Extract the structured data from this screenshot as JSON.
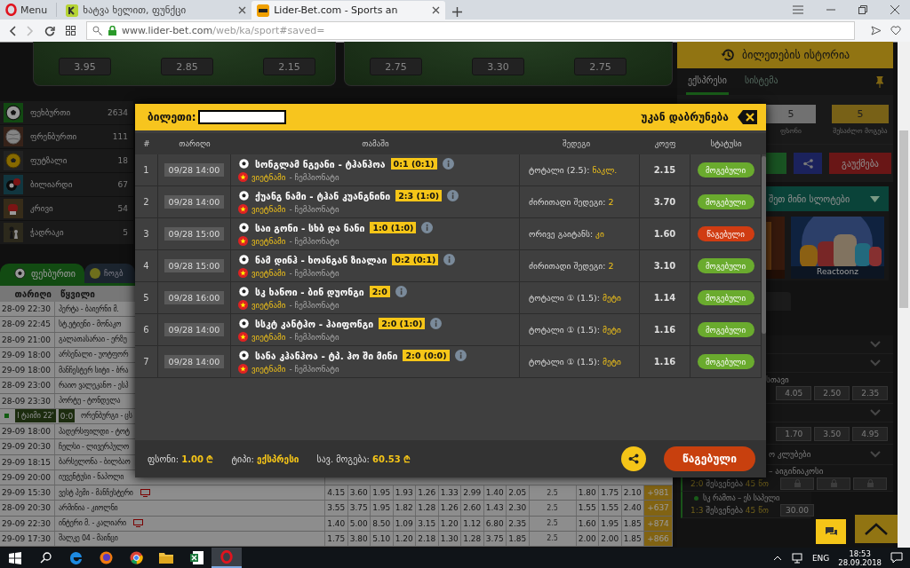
{
  "browser": {
    "menu_label": "Menu",
    "tabs": [
      {
        "label": "ხატვა ხელით, ფუნქცი",
        "selected": false,
        "kind": "quiz"
      },
      {
        "label": "Lider-Bet.com - Sports an",
        "selected": true,
        "kind": "site"
      }
    ],
    "url_host": "www.lider-bet.com",
    "url_path": "/web/ka/sport#saved="
  },
  "featured_cards": [
    {
      "odds": [
        "3.95",
        "2.85",
        "2.15"
      ]
    },
    {
      "odds": [
        "2.75",
        "3.30",
        "2.75"
      ]
    }
  ],
  "sports": [
    {
      "name": "ფეხბურთი",
      "count": "2634",
      "kind": "football"
    },
    {
      "name": "ფრენბურთი",
      "count": "111",
      "kind": "volleyball"
    },
    {
      "name": "ფუტზალი",
      "count": "18",
      "kind": "futsal"
    },
    {
      "name": "ბილიარდი",
      "count": "67",
      "kind": "billiards"
    },
    {
      "name": "კრივი",
      "count": "54",
      "kind": "boxing"
    },
    {
      "name": "ჭადრაკი",
      "count": "5",
      "kind": "chess"
    }
  ],
  "sport_tabs": [
    {
      "label": "ფეხბურთი",
      "selected": true,
      "kind": "football"
    },
    {
      "label": "ჩოგბ",
      "selected": false,
      "kind": "tennis"
    }
  ],
  "matches": {
    "columns": [
      "თარიღი",
      "წყვილი"
    ],
    "rows": [
      {
        "date": "28-09 22:30",
        "teams": "ჰერტა - ბაიერნი მ."
      },
      {
        "date": "28-09 22:45",
        "teams": "სტ.ეტიენი - მონაკო"
      },
      {
        "date": "28-09 21:00",
        "teams": "გალათასარაი - ერზუ"
      },
      {
        "date": "29-09 18:00",
        "teams": "არსენალი - უოტფორ"
      },
      {
        "date": "29-09 18:00",
        "teams": "მანჩესტერ სიტი - ბრა"
      },
      {
        "date": "28-09 23:00",
        "teams": "რაიო ვალეკანო - ესპ"
      },
      {
        "date": "28-09 23:30",
        "teams": "პორტუ - ტონდელა"
      },
      {
        "live": true,
        "period": "I ტაიმი 22'",
        "score": "0:0",
        "teams": "ორენბურგი - ცს"
      },
      {
        "date": "29-09 18:00",
        "teams": "ჰადერსფილდი - ტოტ"
      },
      {
        "date": "29-09 20:30",
        "teams": "ჩელსი - ლივერპულო"
      },
      {
        "date": "29-09 18:15",
        "teams": "ბარსელონა - ბილბაო"
      },
      {
        "date": "29-09 20:00",
        "teams": "იუვენტუსი - ნაპოლი"
      },
      {
        "date": "29-09 15:30",
        "teams": "ვესტ ჰემი - მანჩესტერი",
        "tv": true,
        "odds": [
          "4.15",
          "3.60",
          "1.95",
          "1.93",
          "1.26",
          "1.33",
          "2.99",
          "1.40",
          "2.05"
        ],
        "total": "2.5",
        "total_odds": [
          "1.80",
          "1.75",
          "2.10"
        ],
        "more": "+981"
      },
      {
        "date": "28-09 20:30",
        "teams": "არმინია - კიოლნი",
        "tv": false,
        "odds": [
          "3.55",
          "3.75",
          "1.95",
          "1.82",
          "1.28",
          "1.26",
          "2.60",
          "1.43",
          "2.30"
        ],
        "total": "2.5",
        "total_odds": [
          "1.55",
          "1.55",
          "2.40"
        ],
        "more": "+637"
      },
      {
        "date": "29-09 22:30",
        "teams": "ინტერი მ. - კალიარი",
        "tv": true,
        "odds": [
          "1.40",
          "5.00",
          "8.50",
          "1.09",
          "3.15",
          "1.20",
          "1.12",
          "6.80",
          "2.35"
        ],
        "total": "2.5",
        "total_odds": [
          "1.60",
          "1.95",
          "1.85"
        ],
        "more": "+874"
      },
      {
        "date": "29-09 17:30",
        "teams": "შალკე 04 - მაინცი",
        "tv": false,
        "odds": [
          "1.75",
          "3.80",
          "5.10",
          "1.20",
          "2.18",
          "1.30",
          "1.28",
          "3.75",
          "1.85"
        ],
        "total": "2.5",
        "total_odds": [
          "2.00",
          "2.00",
          "1.85"
        ],
        "more": "+866"
      }
    ]
  },
  "bet_slip": {
    "history_button": "ბილეთების ისტორია",
    "tabs": [
      {
        "label": "ექსპრესი",
        "selected": true
      },
      {
        "label": "სისტემა",
        "selected": false
      }
    ],
    "stake": "5",
    "stake_label": "ფსონი",
    "potential_win": "5",
    "potential_win_label": "შესაძლო მოგება",
    "cancel_button": "გაუქმება"
  },
  "slots": {
    "title": "შეთ მინი სლოტები",
    "games": [
      {
        "kind": "picture"
      },
      {
        "kind": "picture",
        "caption": "Reactoonz"
      }
    ]
  },
  "events": [
    {
      "kind": "collapsed"
    },
    {
      "kind": "collapsed"
    },
    {
      "kind": "match",
      "title": "სთავი",
      "odds": [
        "4.05",
        "2.50",
        "2.35"
      ]
    },
    {
      "kind": "collapsed"
    },
    {
      "kind": "match",
      "odds": [
        "1.70",
        "3.50",
        "4.95"
      ]
    },
    {
      "kind": "league",
      "title": "ო კლუბები"
    },
    {
      "kind": "live",
      "title": "– აიგინიაკოსი",
      "score": "2:0",
      "state": "შესვენება",
      "minute": "45 წთ",
      "locked": true,
      "live_dot": false
    },
    {
      "kind": "live",
      "title": "სკ რამთა – ეს საპელი",
      "score": "1:3",
      "state": "შესვენება",
      "minute": "45 წთ",
      "locked": false,
      "live_dot": true,
      "odds": [
        "30.00"
      ]
    }
  ],
  "ticket": {
    "title": "ბილეთი:",
    "back_label": "უკან დაბრუნება",
    "columns": [
      "#",
      "თარიღი",
      "თამაში",
      "შედეგი",
      "კოეფ",
      "სტატუსი"
    ],
    "rows": [
      {
        "number": "1",
        "date": "09/28 14:00",
        "game": "სონგლამ ნგეანი - ტჰანჰოა",
        "score": "0:1 (0:1)",
        "country": "ვიეტნამი",
        "league": "- ჩემპიონატი",
        "bet": "ტოტალი (2.5):",
        "pick": "ნაკლ.",
        "odds": "2.15",
        "status": "მოგებული",
        "won": true
      },
      {
        "number": "2",
        "date": "09/28 14:00",
        "game": "ქუანგ ნამი - ტჰან კუანგნინი",
        "score": "2:3 (1:0)",
        "country": "ვიეტნამი",
        "league": "- ჩემპიონატი",
        "bet": "ძირითადი შედეგი:",
        "pick": "2",
        "odds": "3.70",
        "status": "მოგებული",
        "won": true
      },
      {
        "number": "3",
        "date": "09/28 15:00",
        "game": "საი გონი - სხბ და ნანი",
        "score": "1:0 (1:0)",
        "country": "ვიეტნამი",
        "league": "- ჩემპიონატი",
        "bet": "ორივე გაიტანს:",
        "pick": "კი",
        "odds": "1.60",
        "status": "წაგებული",
        "won": false
      },
      {
        "number": "4",
        "date": "09/28 15:00",
        "game": "ნამ დინჰ - ხოანგან ზიალაი",
        "score": "0:2 (0:1)",
        "country": "ვიეტნამი",
        "league": "- ჩემპიონატი",
        "bet": "ძირითადი შედეგი:",
        "pick": "2",
        "odds": "3.10",
        "status": "მოგებული",
        "won": true
      },
      {
        "number": "5",
        "date": "09/28 16:00",
        "game": "სკ ხანოი - ბინ დუონგი",
        "score": "2:0",
        "country": "ვიეტნამი",
        "league": "- ჩემპიონატი",
        "bet": "ტოტალი ① (1.5):",
        "pick": "მეტი",
        "odds": "1.14",
        "status": "მოგებული",
        "won": true
      },
      {
        "number": "6",
        "date": "09/28 14:00",
        "game": "სსკტ კანტჰო - ჰაიფონგი",
        "score": "2:0 (1:0)",
        "country": "ვიეტნამი",
        "league": "- ჩემპიონატი",
        "bet": "ტოტალი ① (1.5):",
        "pick": "მეტი",
        "odds": "1.16",
        "status": "მოგებული",
        "won": true
      },
      {
        "number": "7",
        "date": "09/28 14:00",
        "game": "სანა კჰანჰოა - ტპ. ჰო ში მინი",
        "score": "2:0 (0:0)",
        "country": "ვიეტნამი",
        "league": "- ჩემპიონატი",
        "bet": "ტოტალი ① (1.5):",
        "pick": "მეტი",
        "odds": "1.16",
        "status": "მოგებული",
        "won": true
      }
    ],
    "stake_label": "ფსონი:",
    "stake": "1.00 ₾",
    "type_label": "ტიპი:",
    "type": "ექსპრესი",
    "win_label": "სავ. მოგება:",
    "win": "60.53 ₾",
    "result_button": "წაგებული",
    "result_won": false
  },
  "taskbar": {
    "apps": [
      {
        "kind": "edge",
        "selected": false
      },
      {
        "kind": "firefox",
        "selected": false
      },
      {
        "kind": "chrome",
        "selected": false
      },
      {
        "kind": "folder",
        "selected": false
      },
      {
        "kind": "spreadsheet",
        "selected": false
      },
      {
        "kind": "opera",
        "selected": true
      }
    ],
    "language": "ENG",
    "time": "18:53",
    "date": "28.09.2018"
  }
}
